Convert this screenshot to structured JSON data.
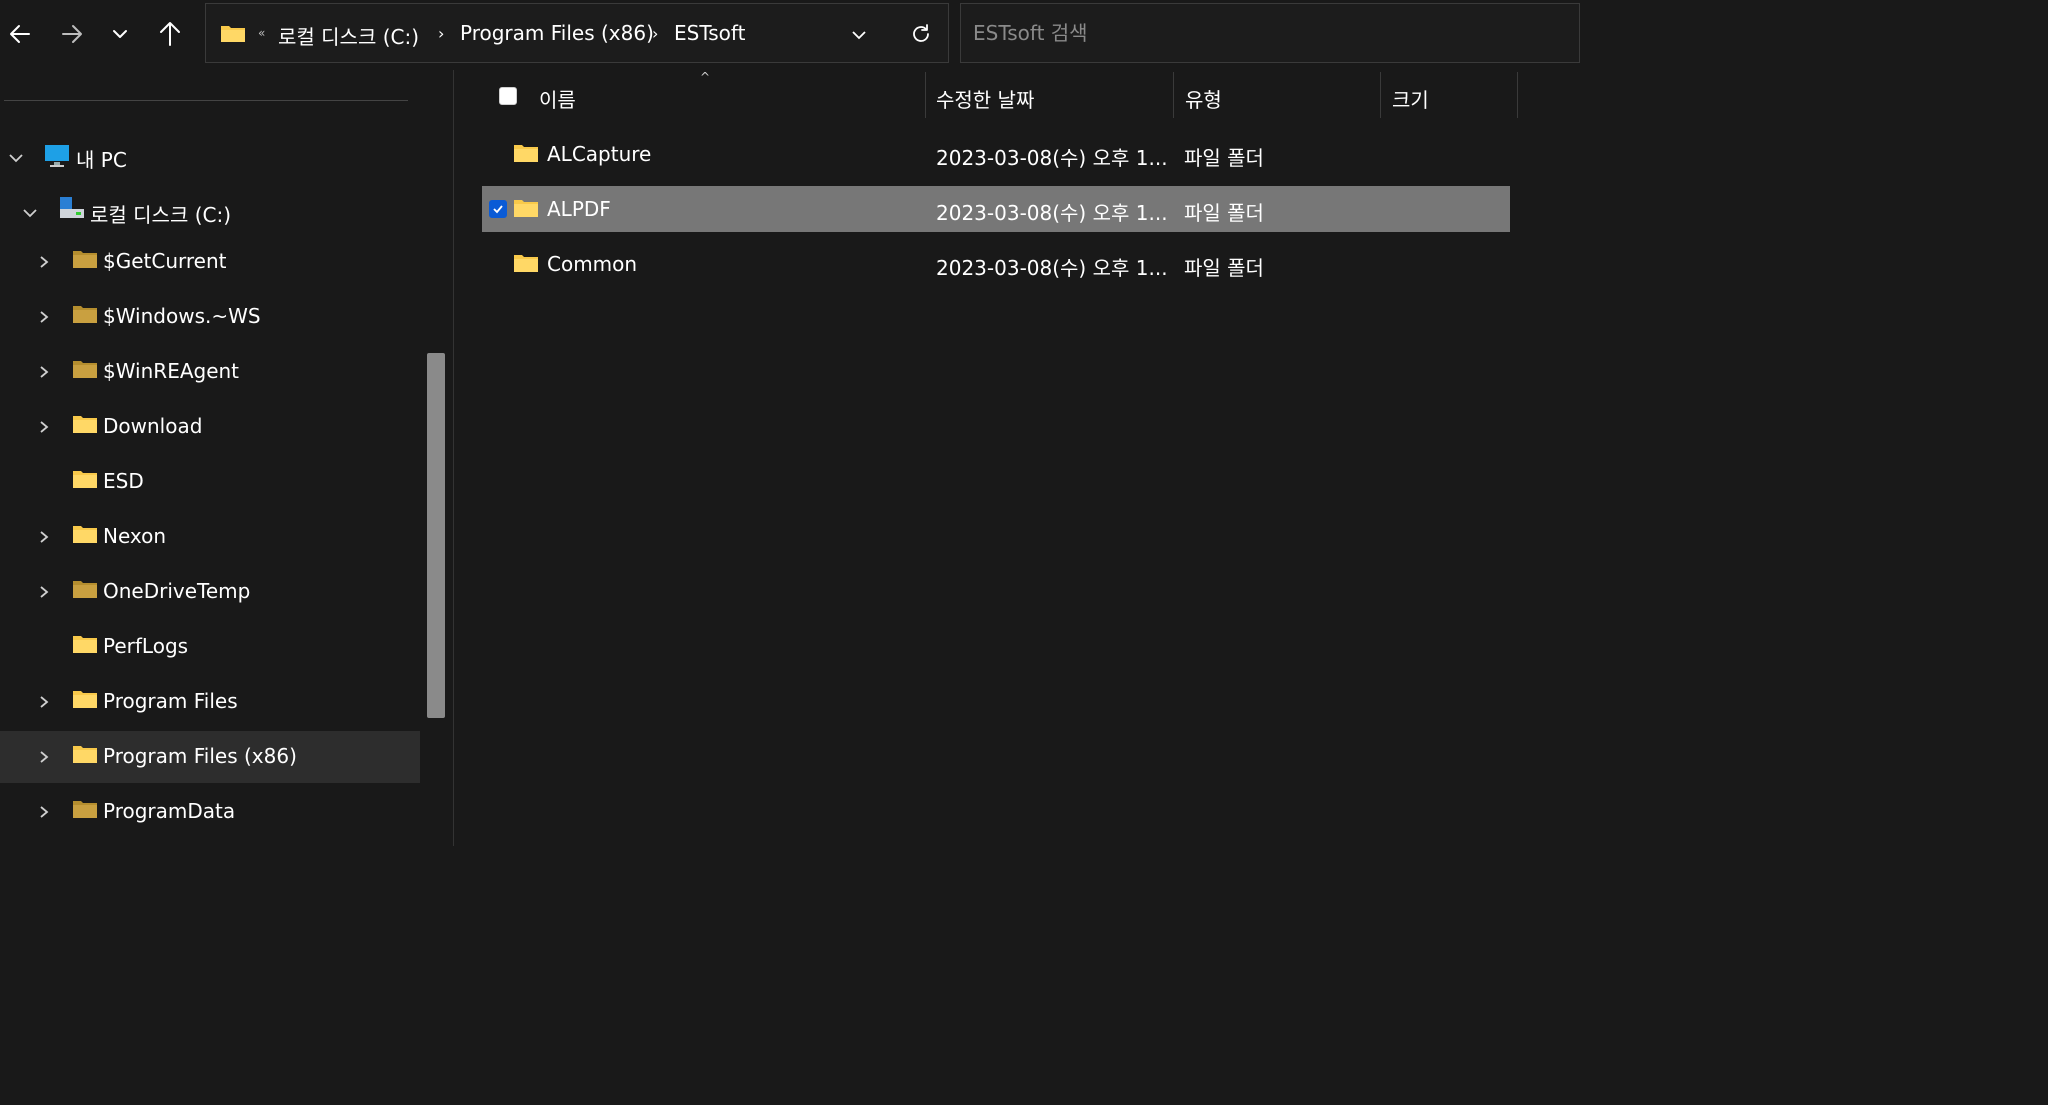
{
  "toolbar": {
    "back_icon": "arrow-left-icon",
    "forward_icon": "arrow-right-icon",
    "recent_icon": "chevron-down-icon",
    "up_icon": "arrow-up-icon"
  },
  "address": {
    "overflow": "«",
    "crumbs": [
      "로컬 디스크 (C:)",
      "Program Files (x86)",
      "ESTsoft"
    ],
    "separator": "›"
  },
  "search": {
    "placeholder": "ESTsoft 검색"
  },
  "sidebar": {
    "items": [
      {
        "label": "내 PC",
        "icon": "monitor-icon"
      },
      {
        "label": "로컬 디스크 (C:)",
        "icon": "drive-icon"
      },
      {
        "label": "$GetCurrent"
      },
      {
        "label": "$Windows.~WS"
      },
      {
        "label": "$WinREAgent"
      },
      {
        "label": "Download"
      },
      {
        "label": "ESD"
      },
      {
        "label": "Nexon"
      },
      {
        "label": "OneDriveTemp"
      },
      {
        "label": "PerfLogs"
      },
      {
        "label": "Program Files"
      },
      {
        "label": "Program Files (x86)"
      },
      {
        "label": "ProgramData"
      }
    ]
  },
  "columns": {
    "name": "이름",
    "date": "수정한 날짜",
    "type": "유형",
    "size": "크기"
  },
  "files": [
    {
      "name": "ALCapture",
      "date": "2023-03-08(수) 오후 1...",
      "type": "파일 폴더",
      "selected": false
    },
    {
      "name": "ALPDF",
      "date": "2023-03-08(수) 오후 1...",
      "type": "파일 폴더",
      "selected": true
    },
    {
      "name": "Common",
      "date": "2023-03-08(수) 오후 1...",
      "type": "파일 폴더",
      "selected": false
    }
  ],
  "colors": {
    "background": "#191919",
    "selected_row": "#777777",
    "sidebar_selected": "#2d2d2d",
    "folder_yellow": "#f8c94a",
    "checkbox_blue": "#0a5bd6"
  }
}
